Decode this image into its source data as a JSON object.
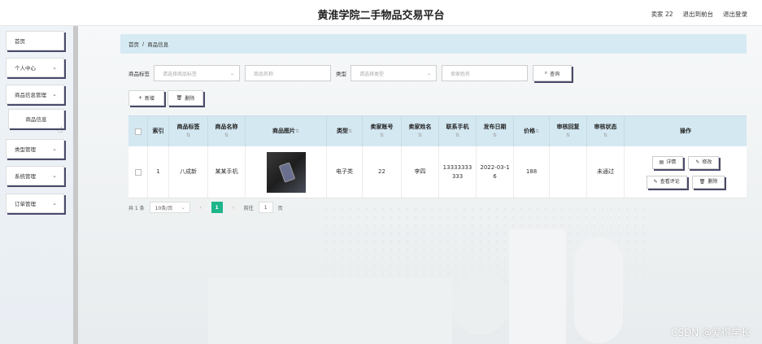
{
  "header": {
    "title": "黄淮学院二手物品交易平台",
    "user": "卖家 22",
    "back_label": "退出到前台",
    "logout_label": "退出登录"
  },
  "sidebar": {
    "items": [
      {
        "label": "首页",
        "has_arrow": false
      },
      {
        "label": "个人中心",
        "has_arrow": true
      },
      {
        "label": "商品信息管理",
        "has_arrow": true
      },
      {
        "label": "商品信息",
        "sub": true
      },
      {
        "label": "类型管理",
        "has_arrow": true
      },
      {
        "label": "系统管理",
        "has_arrow": true
      },
      {
        "label": "订单管理",
        "has_arrow": true
      }
    ]
  },
  "breadcrumb": {
    "home": "首页",
    "sep": "/",
    "current": "商品信息"
  },
  "search": {
    "tag_label": "商品标签",
    "tag_placeholder": "请选择商品标签",
    "name_placeholder": "商品名称",
    "type_label": "类型",
    "type_placeholder": "请选择类型",
    "seller_placeholder": "卖家姓名",
    "button_label": "查询"
  },
  "actions": {
    "add_label": "新增",
    "delete_label": "删除"
  },
  "table": {
    "headers": [
      "索引",
      "商品标签",
      "商品名称",
      "商品图片",
      "类型",
      "卖家账号",
      "卖家姓名",
      "联系手机",
      "发布日期",
      "价格",
      "审核回复",
      "审核状态",
      "操作"
    ],
    "rows": [
      {
        "index": "1",
        "tag": "八成新",
        "name": "某某手机",
        "type": "电子类",
        "seller_account": "22",
        "seller_name": "李四",
        "phone": "13333333333",
        "date": "2022-03-16",
        "price": "188",
        "reply": "",
        "status": "未通过",
        "ops": {
          "detail": "详情",
          "edit": "修改",
          "review": "查看评论",
          "delete": "删除"
        }
      }
    ]
  },
  "pager": {
    "total": "共 1 条",
    "page_size": "10条/页",
    "current_page": "1",
    "goto_label": "前往",
    "goto_value": "1",
    "page_suffix": "页"
  },
  "watermark": "CSDN @爱得学长"
}
